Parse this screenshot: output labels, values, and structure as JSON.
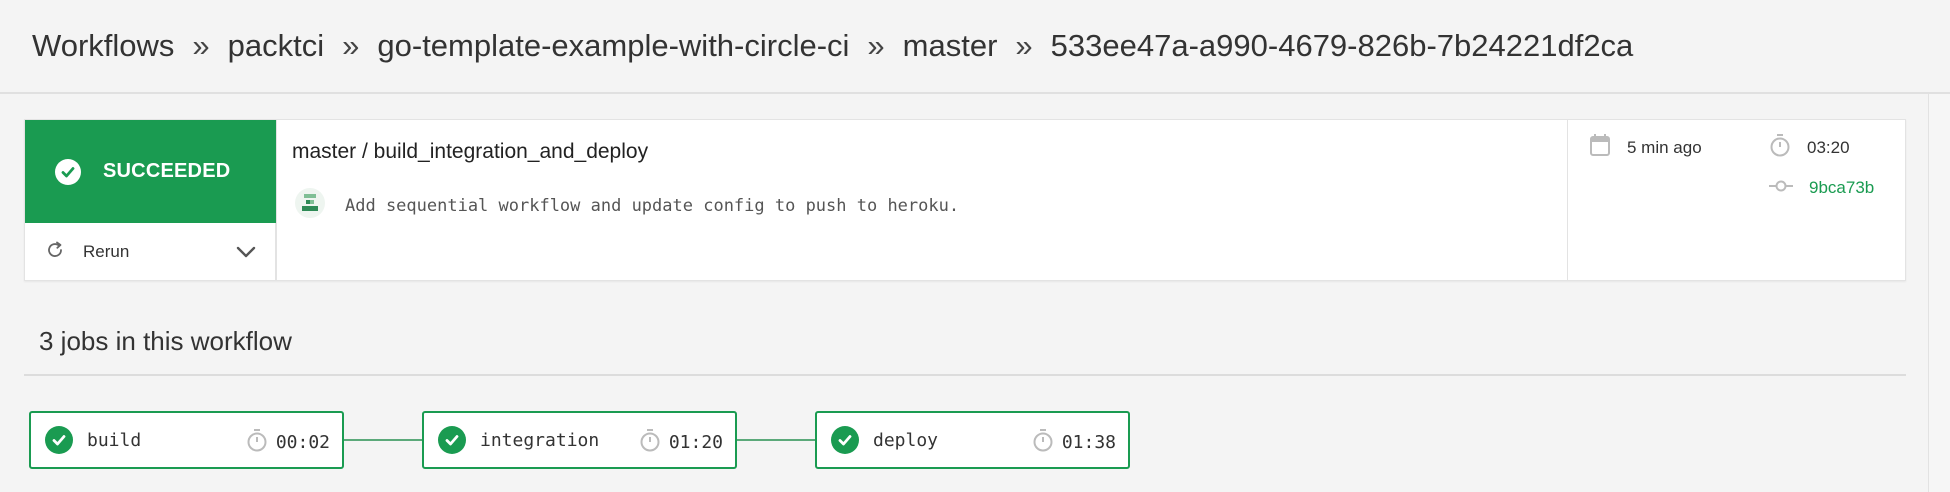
{
  "breadcrumbs": {
    "workflows": "Workflows",
    "org": "packtci",
    "project": "go-template-example-with-circle-ci",
    "branch": "master",
    "workflow_id": "533ee47a-a990-4679-826b-7b24221df2ca",
    "separator": "»"
  },
  "summary": {
    "status": "SUCCEEDED",
    "rerun_label": "Rerun",
    "workflow_title": "master / build_integration_and_deploy",
    "commit_message": "Add sequential workflow and update config to push to heroku.",
    "time_ago": "5 min ago",
    "duration": "03:20",
    "commit_sha": "9bca73b"
  },
  "jobs": {
    "heading": "3 jobs in this workflow",
    "items": [
      {
        "name": "build",
        "duration": "00:02"
      },
      {
        "name": "integration",
        "duration": "01:20"
      },
      {
        "name": "deploy",
        "duration": "01:38"
      }
    ]
  },
  "colors": {
    "success": "#1a9b51",
    "sha_link": "#1a9b51",
    "background": "#f4f4f4"
  },
  "icons": {
    "status": "check-circle-icon",
    "rerun": "refresh-icon",
    "dropdown": "chevron-down-icon",
    "avatar": "identicon-avatar",
    "calendar": "calendar-icon",
    "timer": "stopwatch-icon",
    "commit": "git-commit-icon"
  }
}
